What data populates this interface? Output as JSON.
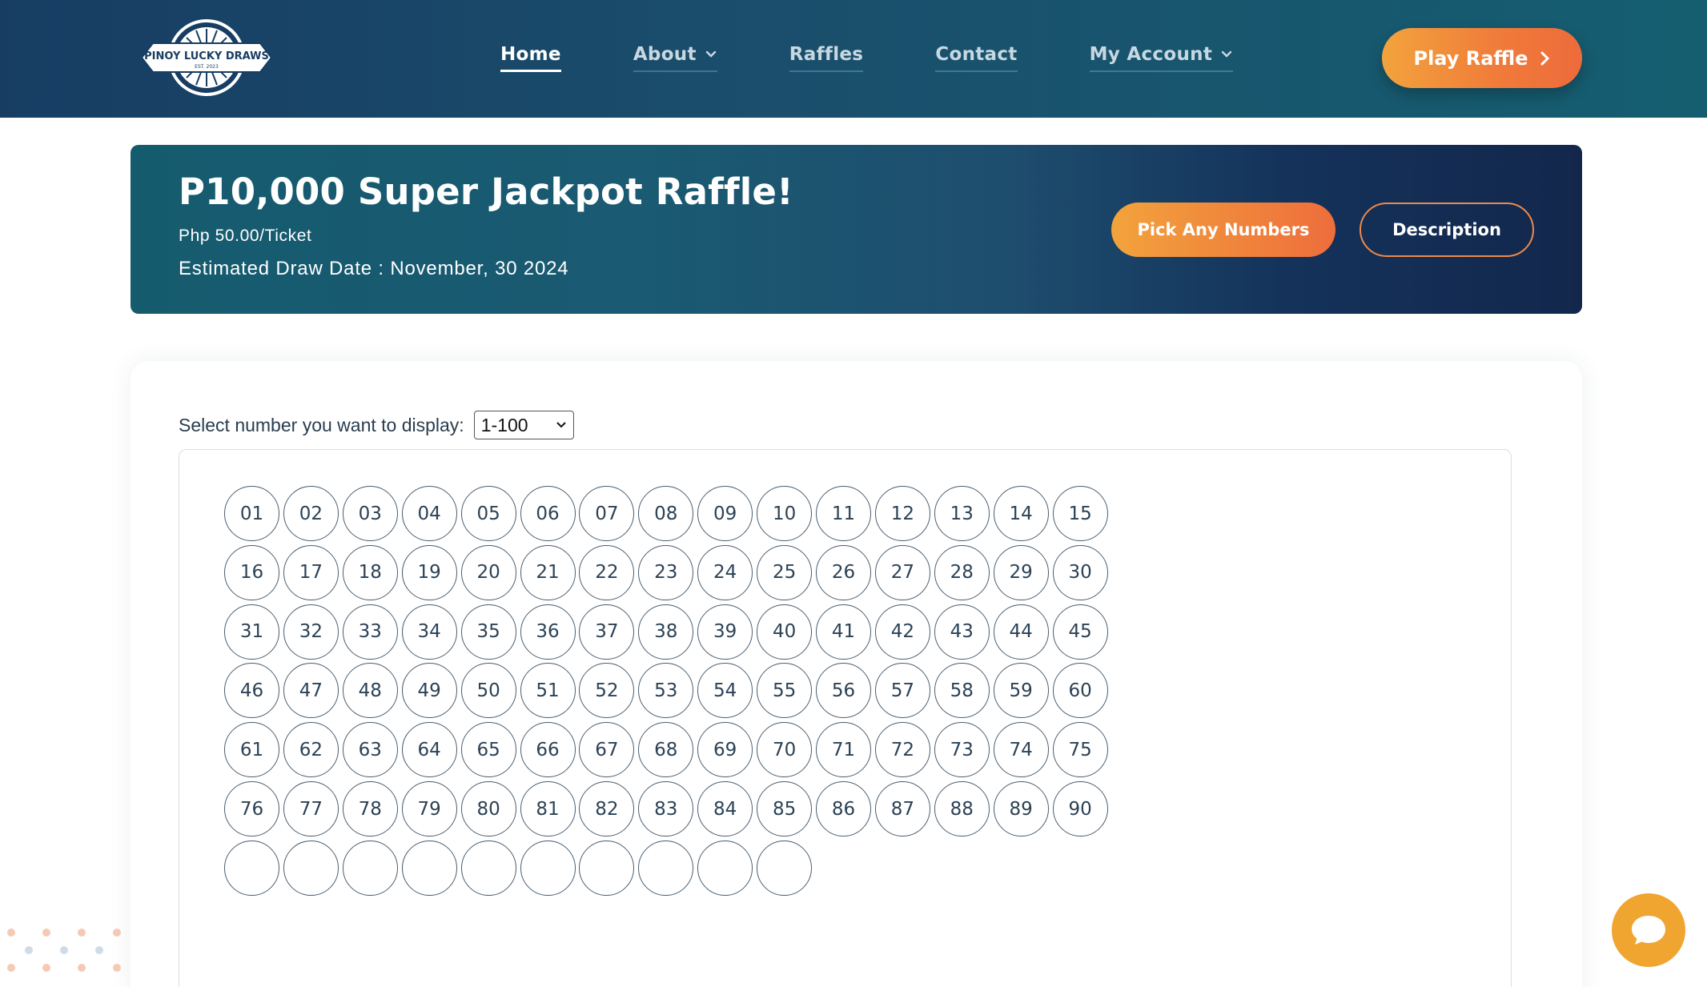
{
  "brand": {
    "logo_text": "PINOY LUCKY DRAWS",
    "logo_subtext": "EST. 2023"
  },
  "nav": {
    "items": [
      {
        "label": "Home",
        "active": true,
        "dropdown": false
      },
      {
        "label": "About",
        "active": false,
        "dropdown": true
      },
      {
        "label": "Raffles",
        "active": false,
        "dropdown": false
      },
      {
        "label": "Contact",
        "active": false,
        "dropdown": false
      },
      {
        "label": "My Account",
        "active": false,
        "dropdown": true
      }
    ],
    "cta_label": "Play Raffle"
  },
  "banner": {
    "title": "P10,000 Super Jackpot Raffle!",
    "price": "Php 50.00/Ticket",
    "draw_date": "Estimated Draw Date : November, 30 2024",
    "pick_label": "Pick Any Numbers",
    "description_label": "Description"
  },
  "selector": {
    "label": "Select number you want to display:",
    "value": "1-100"
  },
  "numbers": [
    "01",
    "02",
    "03",
    "04",
    "05",
    "06",
    "07",
    "08",
    "09",
    "10",
    "11",
    "12",
    "13",
    "14",
    "15",
    "16",
    "17",
    "18",
    "19",
    "20",
    "21",
    "22",
    "23",
    "24",
    "25",
    "26",
    "27",
    "28",
    "29",
    "30",
    "31",
    "32",
    "33",
    "34",
    "35",
    "36",
    "37",
    "38",
    "39",
    "40",
    "41",
    "42",
    "43",
    "44",
    "45",
    "46",
    "47",
    "48",
    "49",
    "50",
    "51",
    "52",
    "53",
    "54",
    "55",
    "56",
    "57",
    "58",
    "59",
    "60",
    "61",
    "62",
    "63",
    "64",
    "65",
    "66",
    "67",
    "68",
    "69",
    "70",
    "71",
    "72",
    "73",
    "74",
    "75",
    "76",
    "77",
    "78",
    "79",
    "80",
    "81",
    "82",
    "83",
    "84",
    "85",
    "86",
    "87",
    "88",
    "89",
    "90",
    "",
    "",
    "",
    "",
    "",
    "",
    "",
    "",
    "",
    ""
  ],
  "colors": {
    "header_start": "#173d63",
    "header_end": "#155e70",
    "accent_orange": "#f07a3a",
    "chat_bubble": "#f0a530"
  },
  "icons": {
    "chat": "chat-bubble-icon",
    "dropdown": "chevron-down-icon",
    "cta_arrow": "chevron-right-icon"
  }
}
